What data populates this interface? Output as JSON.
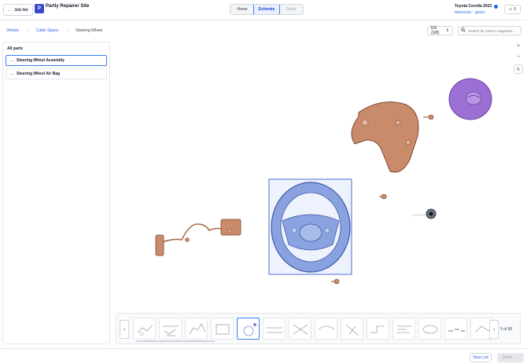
{
  "header": {
    "back_label": "Job list",
    "site_name": "Partly Repairer Site",
    "tabs": [
      {
        "label": "Home",
        "state": "normal"
      },
      {
        "label": "Estimate",
        "state": "active"
      },
      {
        "label": "Order",
        "state": "disabled"
      }
    ],
    "vehicle_title": "Toyota Corolla 2023",
    "vehicle_code": "DBMGN01 - QDEG",
    "cart_count": "0"
  },
  "breadcrumb": [
    "Vehicle",
    "Cabin Space",
    "Steering Wheel"
  ],
  "language": "EN (GB)",
  "search": {
    "placeholder": "Search for parts in diagrams...",
    "value": ""
  },
  "sidebar": {
    "title": "All parts",
    "items": [
      {
        "label": "Steering Wheel Assembly",
        "selected": true
      },
      {
        "label": "Steering Wheel Air Bag",
        "selected": false
      }
    ]
  },
  "zoom": {
    "in": "+",
    "out": "−",
    "reset": "↻"
  },
  "pager": {
    "text": "5 of 60"
  },
  "footer": {
    "view_list": "View List",
    "order": "Order"
  },
  "icons": {
    "back": "arrow-left-icon",
    "cart": "cart-icon",
    "search": "search-icon",
    "chevron": "chevron-right-icon",
    "verified": "verified-dot-icon"
  },
  "colors": {
    "accent": "#2563eb",
    "copper_part": "#c98b6a",
    "highlight_part": "#8aa3e0",
    "airbag": "#9b6fd3"
  }
}
